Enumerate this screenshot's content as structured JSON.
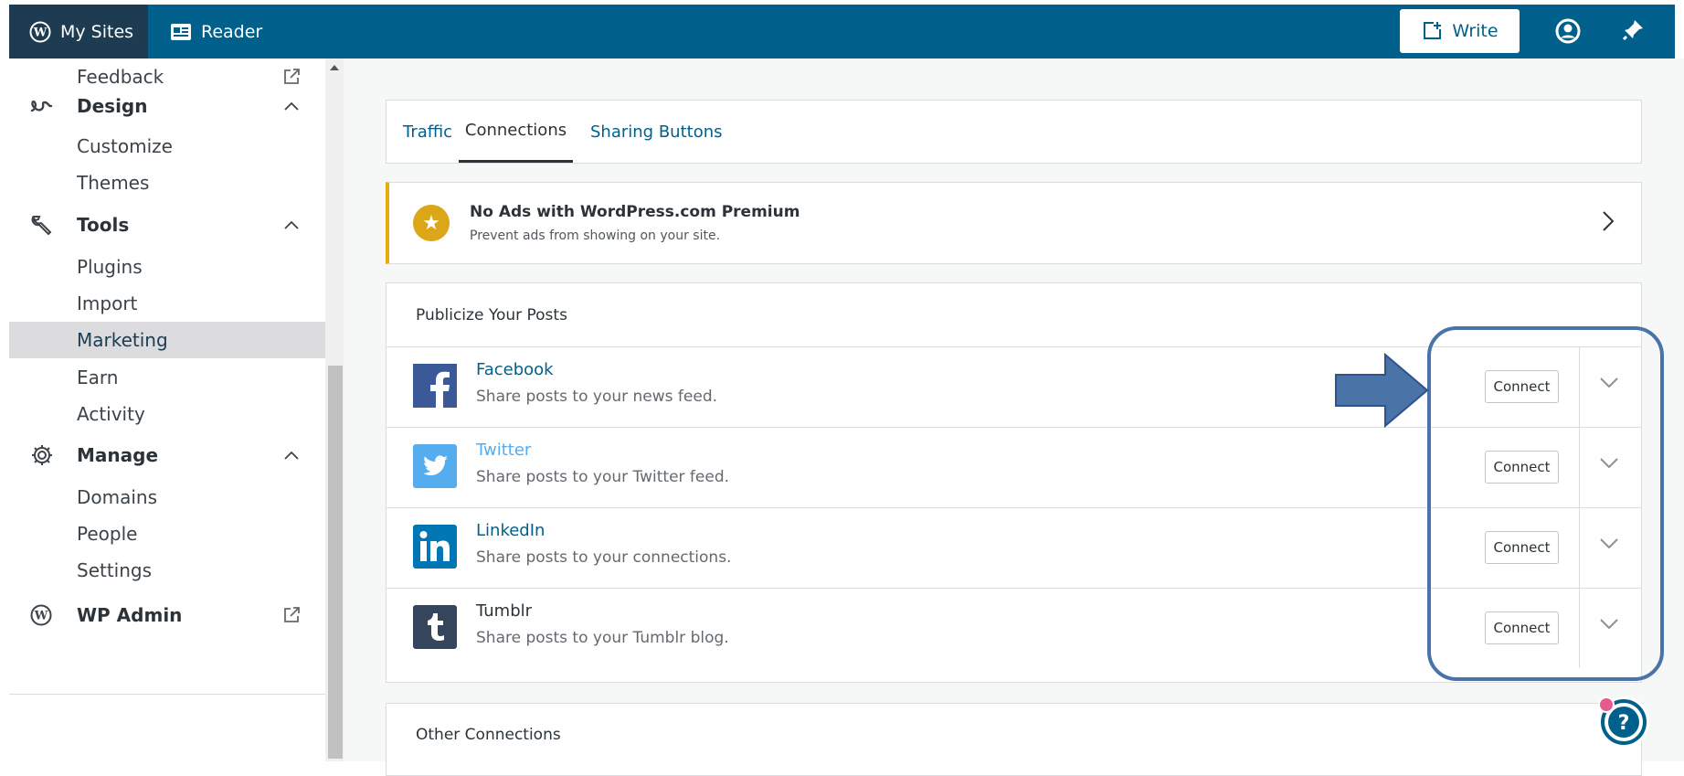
{
  "masterbar": {
    "my_sites": "My Sites",
    "reader": "Reader",
    "write": "Write"
  },
  "sidebar": {
    "feedback": "Feedback",
    "design": "Design",
    "customize": "Customize",
    "themes": "Themes",
    "tools": "Tools",
    "plugins": "Plugins",
    "import": "Import",
    "marketing": "Marketing",
    "earn": "Earn",
    "activity": "Activity",
    "manage": "Manage",
    "domains": "Domains",
    "people": "People",
    "settings": "Settings",
    "wp_admin": "WP Admin"
  },
  "tabs": [
    {
      "label": "Traffic"
    },
    {
      "label": "Connections"
    },
    {
      "label": "Sharing Buttons"
    }
  ],
  "banner": {
    "title": "No Ads with WordPress.com Premium",
    "description": "Prevent ads from showing on your site."
  },
  "publicize": {
    "header": "Publicize Your Posts",
    "services": [
      {
        "name": "Facebook",
        "description": "Share posts to your news feed.",
        "button": "Connect",
        "color": "#3b5998"
      },
      {
        "name": "Twitter",
        "description": "Share posts to your Twitter feed.",
        "button": "Connect",
        "color": "#55acee"
      },
      {
        "name": "LinkedIn",
        "description": "Share posts to your connections.",
        "button": "Connect",
        "color": "#0077b5"
      },
      {
        "name": "Tumblr",
        "description": "Share posts to your Tumblr blog.",
        "button": "Connect",
        "color": "#35465c"
      }
    ]
  },
  "other": {
    "title": "Other Connections"
  },
  "colors": {
    "masterbar": "#00608c",
    "my_sites_bg": "#1d3c52",
    "link": "#00608c",
    "annotation": "#4a73a8",
    "premium_star": "#dba617"
  }
}
